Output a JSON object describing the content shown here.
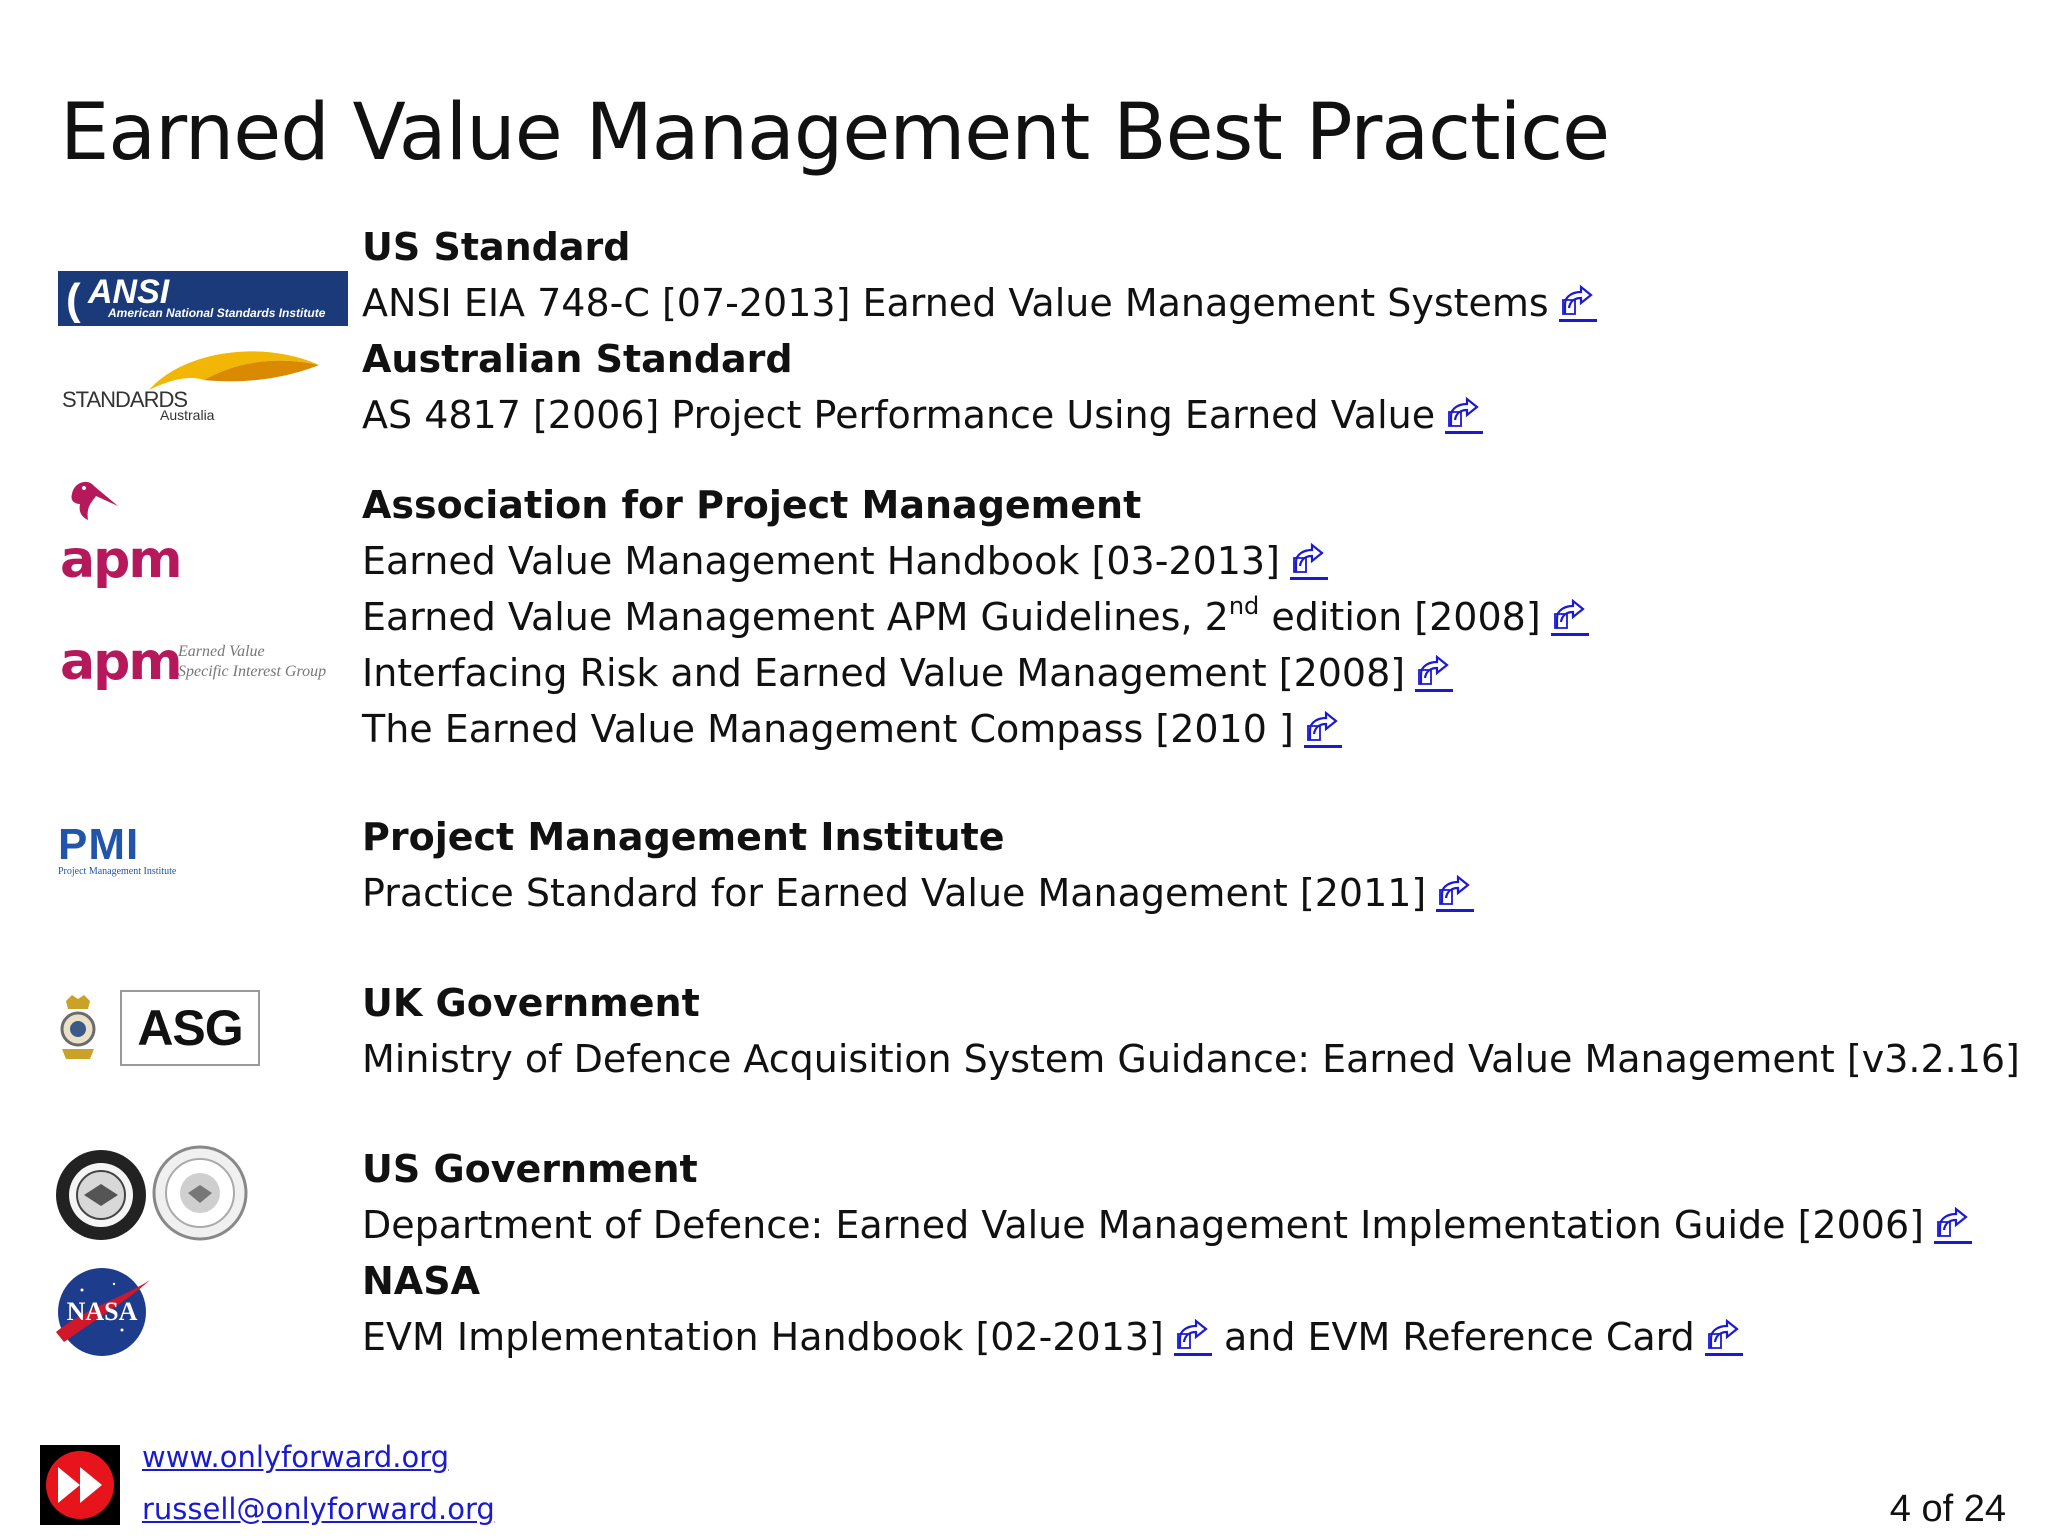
{
  "slide": {
    "title": "Earned Value Management Best Practice"
  },
  "logos": {
    "ansi": {
      "name": "ANSI",
      "subtitle": "American National Standards Institute"
    },
    "standards_australia": {
      "line1": "STANDARDS",
      "line2": "Australia"
    },
    "apm": {
      "name": "apm"
    },
    "apm_sig": {
      "name": "apm",
      "line1": "Earned Value",
      "line2": "Specific Interest Group"
    },
    "pmi": {
      "name": "PMI",
      "subtitle": "Project Management Institute"
    },
    "asg": {
      "name": "ASG"
    },
    "nasa": {
      "name": "NASA"
    }
  },
  "sections": {
    "us_standard": {
      "heading": "US Standard",
      "item1": "ANSI EIA 748-C [07-2013] Earned Value Management Systems"
    },
    "au_standard": {
      "heading": "Australian Standard",
      "item1": "AS 4817 [2006] Project Performance Using Earned Value"
    },
    "apm": {
      "heading": "Association for Project Management",
      "item1": "Earned Value Management Handbook [03-2013]",
      "item2_pre": "Earned Value Management APM Guidelines, 2",
      "item2_sup": "nd",
      "item2_post": " edition [2008]",
      "item3": "Interfacing Risk and Earned Value Management [2008]",
      "item4": "The Earned Value Management Compass [2010 ]"
    },
    "pmi": {
      "heading": "Project Management Institute",
      "item1": "Practice Standard for Earned Value Management [2011]"
    },
    "uk_gov": {
      "heading": "UK Government",
      "item1": "Ministry of Defence Acquisition System Guidance: Earned Value Management [v3.2.16]"
    },
    "us_gov": {
      "heading": "US Government",
      "item1": "Department of Defence: Earned Value Management Implementation Guide [2006]"
    },
    "nasa": {
      "heading": "NASA",
      "item1_a": "EVM Implementation Handbook [02-2013]",
      "item1_join": " and EVM Reference Card"
    }
  },
  "footer": {
    "website": "www.onlyforward.org",
    "email": "russell@onlyforward.org",
    "page": "4 of 24"
  },
  "icons": {
    "link": "external-link-icon",
    "brand": "fast-forward-icon"
  },
  "colors": {
    "link": "#1a1ad0",
    "apm": "#b5195c",
    "ansi": "#1b3a7a",
    "pmi": "#2255aa",
    "nasa": "#1e3c8c",
    "nasa_red": "#d0182a"
  }
}
